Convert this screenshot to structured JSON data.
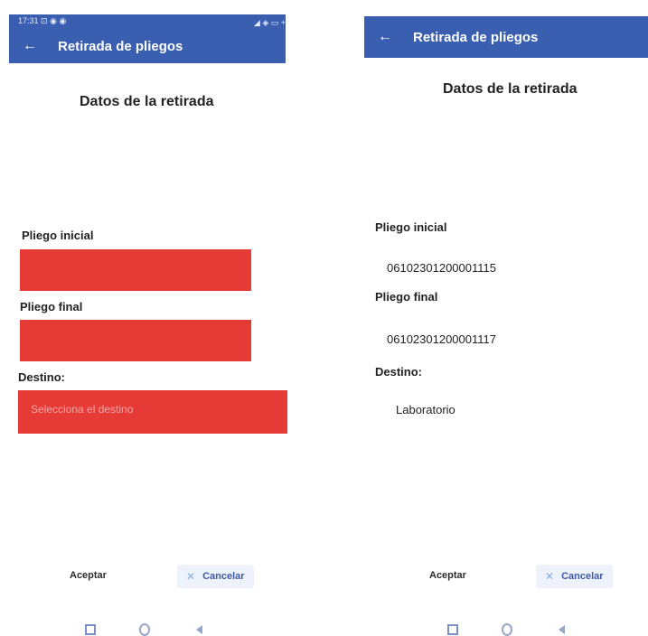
{
  "left": {
    "status": {
      "time": "17:31",
      "indicators": "⊡ ◉ ◉",
      "right": "◢ ◈ ▭ +"
    },
    "title": "Retirada de pliegos",
    "section_title": "Datos de la retirada",
    "pliego_inicial_label": "Pliego inicial",
    "pliego_final_label": "Pliego final",
    "destino_label": "Destino:",
    "destino_placeholder": "Selecciona el destino",
    "accept_label": "Aceptar",
    "cancel_label": "Cancelar"
  },
  "right": {
    "title": "Retirada de pliegos",
    "section_title": "Datos de la retirada",
    "pliego_inicial_label": "Pliego inicial",
    "pliego_inicial_value": "06102301200001115",
    "pliego_final_label": "Pliego final",
    "pliego_final_value": "06102301200001117",
    "destino_label": "Destino:",
    "destino_value": "Laboratorio",
    "accept_label": "Aceptar",
    "cancel_label": "Cancelar"
  },
  "icons": {
    "back": "arrow-left",
    "cancel": "close-x",
    "nav": [
      "recents-square",
      "home-circle",
      "back-triangle"
    ]
  },
  "colors": {
    "appbar": "#3a5fb0",
    "error_field": "#e53a36",
    "cancel_text": "#3f5aa6"
  }
}
